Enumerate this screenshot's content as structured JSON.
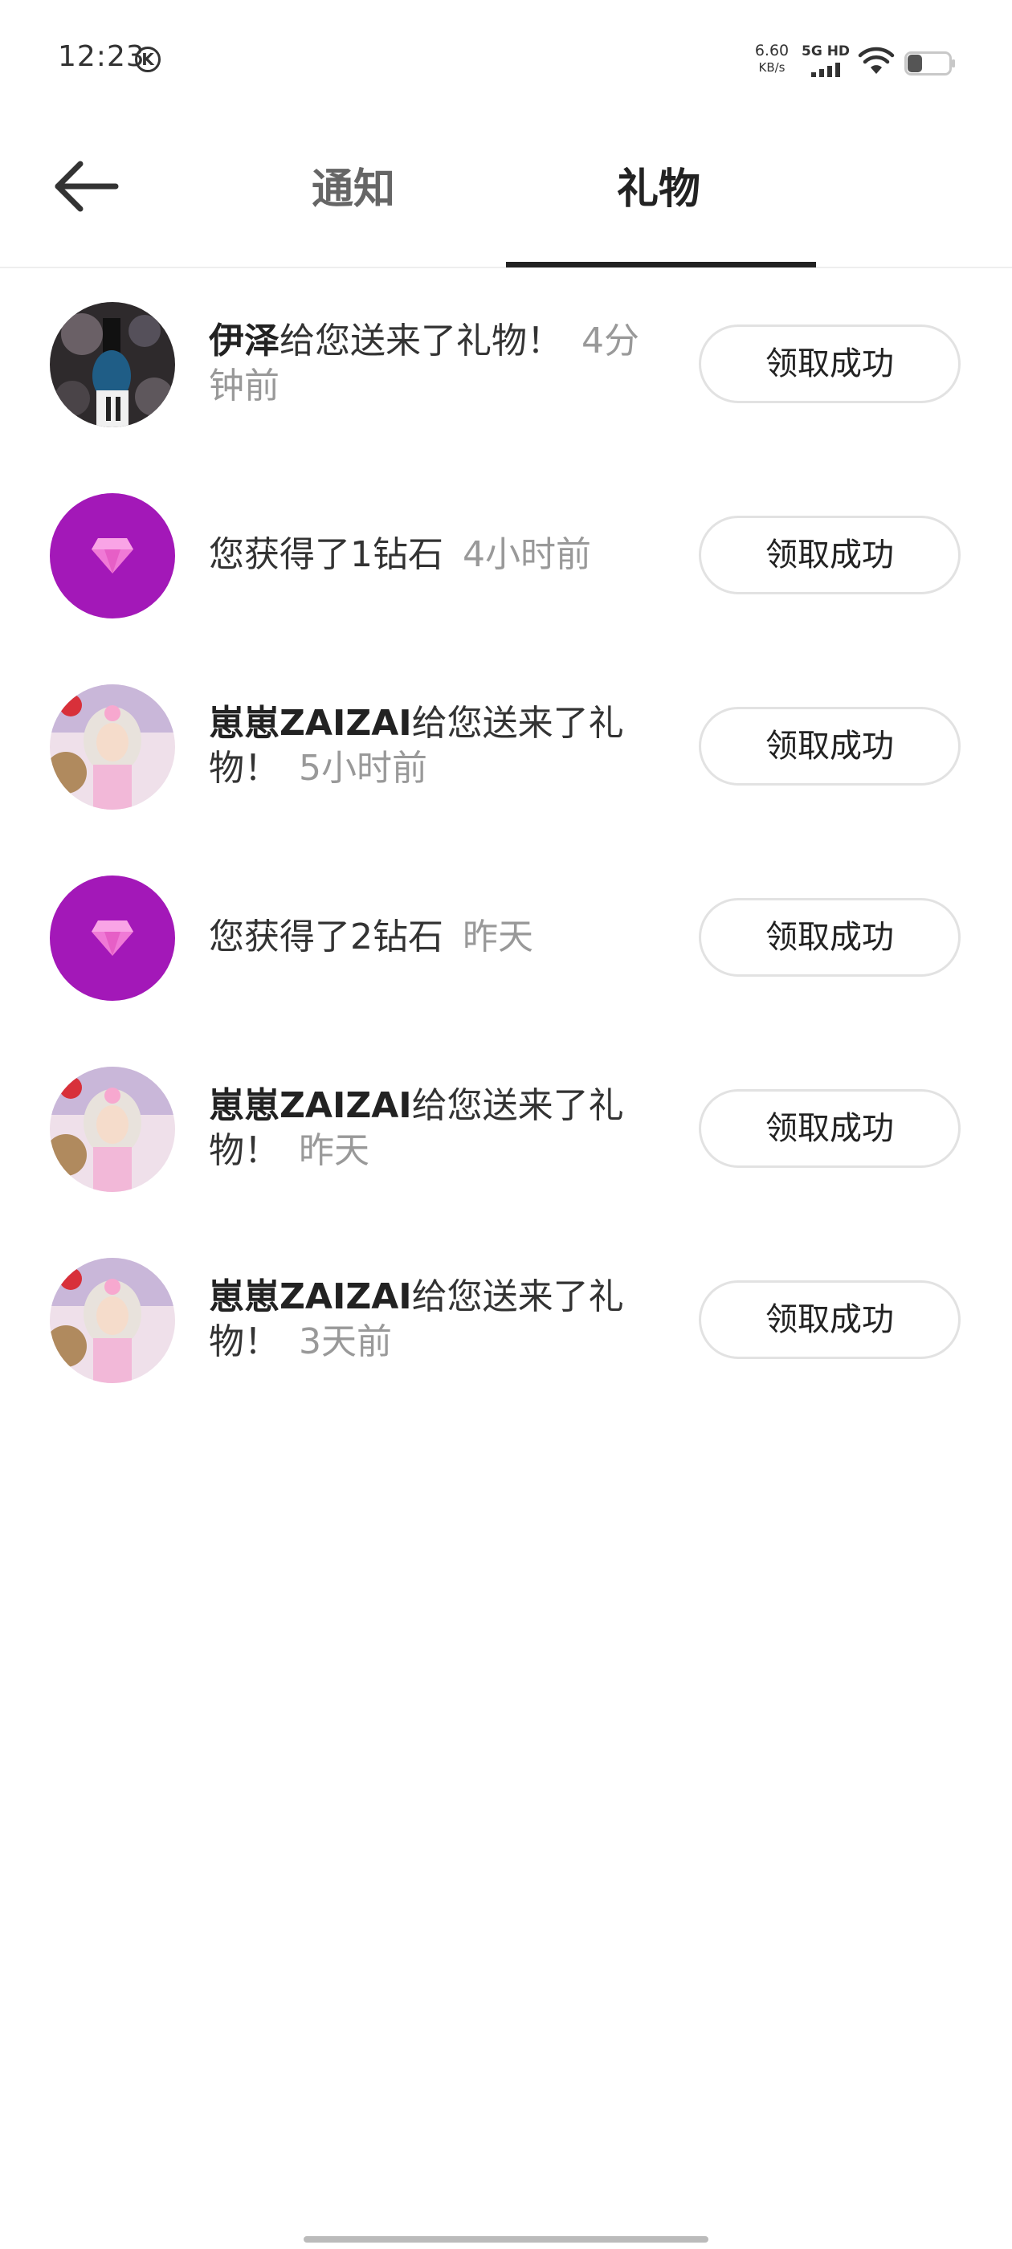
{
  "status_bar": {
    "time": "12:23",
    "k_icon_letter": "K",
    "speed_value": "6.60",
    "speed_unit": "KB/s",
    "network_label": "5G HD",
    "battery_level": 0.35
  },
  "header": {
    "tabs": [
      {
        "label": "通知",
        "active": false
      },
      {
        "label": "礼物",
        "active": true
      }
    ]
  },
  "gifts": [
    {
      "sender": "伊泽",
      "message": "给您送来了礼物！",
      "time": "4分钟前",
      "button": "领取成功",
      "avatar": "dark-portrait"
    },
    {
      "sender": "",
      "message": "您获得了1钻石",
      "time": "4小时前",
      "button": "领取成功",
      "avatar": "diamond"
    },
    {
      "sender": "崽崽ZAIZAI",
      "message": "给您送来了礼物！",
      "time": "5小时前",
      "button": "领取成功",
      "avatar": "doll-portrait"
    },
    {
      "sender": "",
      "message": "您获得了2钻石",
      "time": "昨天",
      "button": "领取成功",
      "avatar": "diamond"
    },
    {
      "sender": "崽崽ZAIZAI",
      "message": "给您送来了礼物！",
      "time": "昨天",
      "button": "领取成功",
      "avatar": "doll-portrait"
    },
    {
      "sender": "崽崽ZAIZAI",
      "message": "给您送来了礼物！",
      "time": "3天前",
      "button": "领取成功",
      "avatar": "doll-portrait"
    }
  ],
  "colors": {
    "diamond_bg": "#a318b8",
    "diamond_gem": "#f06bd0",
    "tab_indicator": "#222222",
    "time_text": "#999999"
  }
}
